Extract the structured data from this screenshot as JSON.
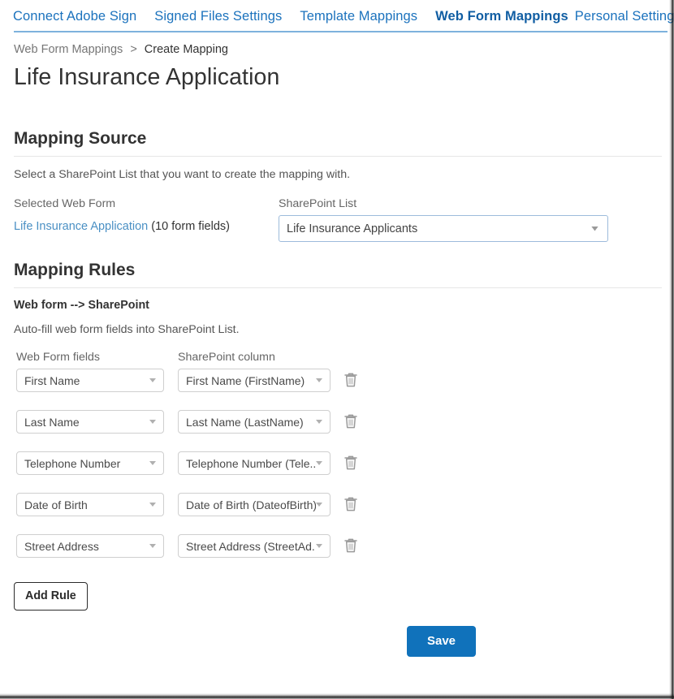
{
  "nav": {
    "items": [
      {
        "label": "Connect Adobe Sign",
        "active": false
      },
      {
        "label": "Signed Files Settings",
        "active": false
      },
      {
        "label": "Template Mappings",
        "active": false
      },
      {
        "label": "Web Form Mappings",
        "active": true
      },
      {
        "label": "Personal Settings",
        "active": false
      }
    ]
  },
  "breadcrumb": {
    "parent": "Web Form Mappings",
    "separator": ">",
    "current": "Create Mapping"
  },
  "page": {
    "title": "Life Insurance Application"
  },
  "mapping_source": {
    "heading": "Mapping Source",
    "hint": "Select a SharePoint List that you want to create the mapping with.",
    "selected_web_form_label": "Selected Web Form",
    "sharepoint_list_label": "SharePoint List",
    "web_form_name": "Life Insurance Application",
    "web_form_fields_count": "(10 form fields)",
    "sharepoint_list_value": "Life Insurance Applicants",
    "sharepoint_list_icon": "chevron-down-icon"
  },
  "mapping_rules": {
    "heading": "Mapping Rules",
    "direction_label": "Web form --> SharePoint",
    "hint": "Auto-fill web form fields into SharePoint List.",
    "col_web_form": "Web Form fields",
    "col_sharepoint": "SharePoint column",
    "delete_icon": "trash-icon",
    "dropdown_icon": "chevron-down-icon",
    "rows": [
      {
        "web_form_field": "First Name",
        "sharepoint_column": "First Name (FirstName)"
      },
      {
        "web_form_field": "Last Name",
        "sharepoint_column": "Last Name (LastName)"
      },
      {
        "web_form_field": "Telephone Number",
        "sharepoint_column": "Telephone Number (Tele..."
      },
      {
        "web_form_field": "Date of Birth",
        "sharepoint_column": "Date of Birth (DateofBirth)"
      },
      {
        "web_form_field": "Street Address",
        "sharepoint_column": "Street Address (StreetAd..."
      }
    ],
    "add_rule_label": "Add Rule"
  },
  "footer": {
    "save_label": "Save"
  },
  "colors": {
    "link_blue": "#1b72bd",
    "active_blue": "#115ea3",
    "nav_rule": "#7eb2dd",
    "save_blue": "#1072bb",
    "select_border": "#cfcfcf",
    "list_select_border": "#9dbbdb",
    "text_dark": "#333333",
    "text_muted": "#666666"
  }
}
